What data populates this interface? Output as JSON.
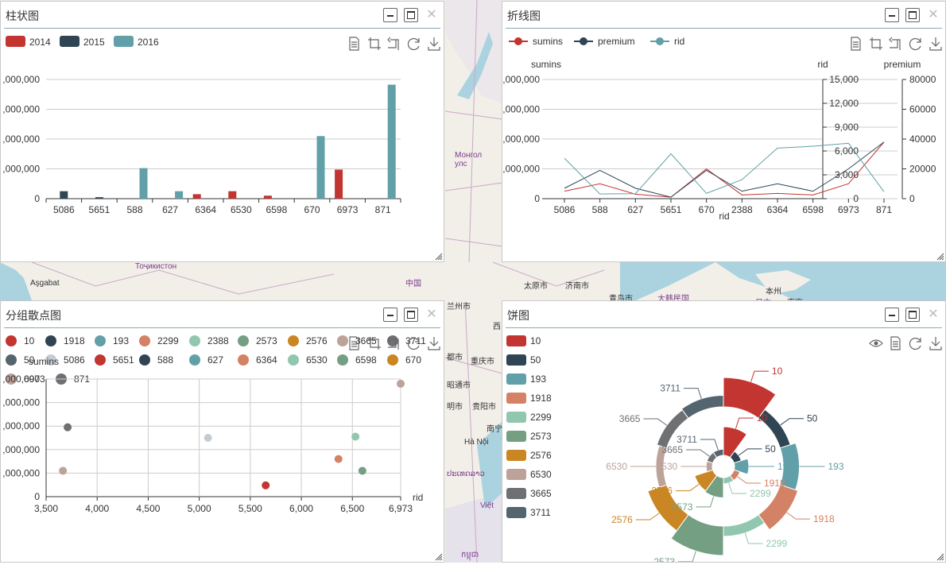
{
  "map": {
    "labels": [
      {
        "text": "Монгол",
        "sub": "улс",
        "cls": "purple"
      },
      {
        "text": "Тоҷикистон",
        "cls": "purple"
      },
      {
        "text": "Aşgabat",
        "cls": ""
      },
      {
        "text": "中国",
        "cls": "purple"
      },
      {
        "text": "太原市",
        "cls": ""
      },
      {
        "text": "济南市",
        "cls": ""
      },
      {
        "text": "青岛市",
        "cls": ""
      },
      {
        "text": "大韩民国",
        "cls": "purple"
      },
      {
        "text": "本州",
        "cls": ""
      },
      {
        "text": "日本",
        "cls": "purple"
      },
      {
        "text": "東京",
        "cls": ""
      },
      {
        "text": "兰州市",
        "cls": ""
      },
      {
        "text": "西",
        "cls": ""
      },
      {
        "text": "都市",
        "cls": ""
      },
      {
        "text": "重庆市",
        "cls": ""
      },
      {
        "text": "昭通市",
        "cls": ""
      },
      {
        "text": "明市",
        "cls": ""
      },
      {
        "text": "贵阳市",
        "cls": ""
      },
      {
        "text": "南宁",
        "cls": ""
      },
      {
        "text": "Hà Nội",
        "cls": ""
      },
      {
        "text": "ປະເທດລາວ",
        "cls": "purple"
      },
      {
        "text": "Việt",
        "cls": "purple"
      },
      {
        "text": "កម្ពុជា",
        "cls": "purple"
      }
    ]
  },
  "panels": {
    "bar": {
      "title": "柱状图"
    },
    "line": {
      "title": "折线图"
    },
    "scatter": {
      "title": "分组散点图"
    },
    "pie": {
      "title": "饼图"
    }
  },
  "colors": {
    "red": "#c23531",
    "navy": "#2f4554",
    "teal": "#61a0a8",
    "salmon": "#d48265",
    "mint": "#91c7ae",
    "green": "#749f83",
    "orange": "#ca8622",
    "rose": "#bda29a",
    "grey": "#6e7074",
    "slate": "#546570",
    "light": "#c4ccd3"
  },
  "toolbar_icons": [
    "data-view-icon",
    "zoom-select-icon",
    "zoom-reset-icon",
    "restore-icon",
    "save-image-icon"
  ],
  "chart_data": [
    {
      "type": "bar",
      "title": "柱状图",
      "categories": [
        "5086",
        "5651",
        "588",
        "627",
        "6364",
        "6530",
        "6598",
        "670",
        "6973",
        "871"
      ],
      "series": [
        {
          "name": "2014",
          "color": "#c23531",
          "values": [
            null,
            null,
            null,
            null,
            300000,
            500000,
            200000,
            null,
            1950000,
            null
          ]
        },
        {
          "name": "2015",
          "color": "#2f4554",
          "values": [
            500000,
            100000,
            null,
            null,
            null,
            null,
            null,
            null,
            null,
            null
          ]
        },
        {
          "name": "2016",
          "color": "#61a0a8",
          "values": [
            null,
            null,
            2050000,
            500000,
            null,
            null,
            null,
            4200000,
            null,
            7650000
          ]
        }
      ],
      "ylim": [
        0,
        8000000
      ],
      "yticks": [
        "0",
        ",000,000",
        ",000,000",
        ",000,000",
        ",000,000"
      ],
      "legend_position": "top-left",
      "grid": true
    },
    {
      "type": "line",
      "title": "折线图",
      "categories": [
        "5086",
        "588",
        "627",
        "5651",
        "670",
        "2388",
        "6364",
        "6598",
        "6973",
        "871"
      ],
      "xlabel": "rid",
      "series": [
        {
          "name": "sumins",
          "color": "#c23531",
          "axis": "sumins",
          "values": [
            500000,
            1000000,
            300000,
            100000,
            2000000,
            250000,
            350000,
            250000,
            1000000,
            3800000
          ]
        },
        {
          "name": "premium",
          "color": "#2f4554",
          "axis": "premium",
          "values": [
            7000,
            19000,
            7000,
            1000,
            19000,
            5000,
            10000,
            5000,
            20000,
            38000
          ]
        },
        {
          "name": "rid",
          "color": "#61a0a8",
          "axis": "rid",
          "values": [
            5086,
            588,
            627,
            5651,
            670,
            2388,
            6364,
            6598,
            6973,
            871
          ]
        }
      ],
      "axes": {
        "sumins": {
          "label": "sumins",
          "lim": [
            0,
            8000000
          ],
          "ticks": [
            "0",
            ",000,000",
            ",000,000",
            ",000,000",
            ",000,000"
          ]
        },
        "rid": {
          "label": "rid",
          "lim": [
            0,
            15000
          ],
          "ticks": [
            "0",
            "3,000",
            "6,000",
            "9,000",
            "12,000",
            "15,000"
          ]
        },
        "premium": {
          "label": "premium",
          "lim": [
            0,
            80000
          ],
          "ticks": [
            "0",
            "20000",
            "40000",
            "60000",
            "80000"
          ]
        }
      },
      "legend_position": "top-left",
      "grid": true
    },
    {
      "type": "scatter",
      "title": "分组散点图",
      "xlabel": "rid",
      "ylabel": "sumins",
      "xlim": [
        3500,
        6973
      ],
      "ylim": [
        0,
        5000000
      ],
      "xticks": [
        "3,500",
        "4,000",
        "4,500",
        "5,000",
        "5,500",
        "6,000",
        "6,500",
        "6,973"
      ],
      "yticks": [
        "0",
        "1,000,000",
        "2,000,000",
        "3,000,000",
        "4,000,000",
        "5,000,000"
      ],
      "ytick_labels_visible": [
        "0",
        ",000,000",
        ",000,000",
        ",000,000",
        ",000,000",
        ",000,000"
      ],
      "legend": [
        {
          "name": "10",
          "color": "#c23531"
        },
        {
          "name": "1918",
          "color": "#2f4554"
        },
        {
          "name": "193",
          "color": "#61a0a8"
        },
        {
          "name": "2299",
          "color": "#d48265"
        },
        {
          "name": "2388",
          "color": "#91c7ae"
        },
        {
          "name": "2573",
          "color": "#749f83"
        },
        {
          "name": "2576",
          "color": "#ca8622"
        },
        {
          "name": "3665",
          "color": "#bda29a"
        },
        {
          "name": "3711",
          "color": "#6e7074"
        },
        {
          "name": "50",
          "color": "#546570"
        },
        {
          "name": "5086",
          "color": "#c4ccd3"
        },
        {
          "name": "5651",
          "color": "#c23531"
        },
        {
          "name": "588",
          "color": "#2f4554"
        },
        {
          "name": "627",
          "color": "#61a0a8"
        },
        {
          "name": "6364",
          "color": "#d48265"
        },
        {
          "name": "6530",
          "color": "#91c7ae"
        },
        {
          "name": "6598",
          "color": "#749f83"
        },
        {
          "name": "670",
          "color": "#ca8622"
        },
        {
          "name": "6973",
          "color": "#bda29a"
        },
        {
          "name": "871",
          "color": "#6e7074"
        }
      ],
      "points": [
        {
          "series": "3665",
          "x": 3665,
          "y": 1100000,
          "color": "#bda29a"
        },
        {
          "series": "3711",
          "x": 3711,
          "y": 2950000,
          "color": "#6e7074"
        },
        {
          "series": "5086",
          "x": 5086,
          "y": 2500000,
          "color": "#c4ccd3"
        },
        {
          "series": "5651",
          "x": 5651,
          "y": 480000,
          "color": "#c23531"
        },
        {
          "series": "6364",
          "x": 6364,
          "y": 1600000,
          "color": "#d48265"
        },
        {
          "series": "6530",
          "x": 6530,
          "y": 2550000,
          "color": "#91c7ae"
        },
        {
          "series": "6598",
          "x": 6598,
          "y": 1100000,
          "color": "#749f83"
        },
        {
          "series": "6973",
          "x": 6973,
          "y": 4800000,
          "color": "#bda29a"
        }
      ],
      "grid": true
    },
    {
      "type": "pie",
      "title": "饼图",
      "legend": [
        {
          "name": "10",
          "color": "#c23531"
        },
        {
          "name": "50",
          "color": "#2f4554"
        },
        {
          "name": "193",
          "color": "#61a0a8"
        },
        {
          "name": "1918",
          "color": "#d48265"
        },
        {
          "name": "2299",
          "color": "#91c7ae"
        },
        {
          "name": "2573",
          "color": "#749f83"
        },
        {
          "name": "2576",
          "color": "#ca8622"
        },
        {
          "name": "6530",
          "color": "#bda29a"
        },
        {
          "name": "3665",
          "color": "#6e7074"
        },
        {
          "name": "3711",
          "color": "#546570"
        }
      ],
      "rings": {
        "outer": [
          {
            "name": "10",
            "value": 100,
            "color": "#c23531"
          },
          {
            "name": "50",
            "value": 22,
            "color": "#2f4554"
          },
          {
            "name": "193",
            "value": 45,
            "color": "#61a0a8"
          },
          {
            "name": "1918",
            "value": 55,
            "color": "#d48265"
          },
          {
            "name": "2299",
            "value": 20,
            "color": "#91c7ae"
          },
          {
            "name": "2573",
            "value": 100,
            "color": "#749f83"
          },
          {
            "name": "2576",
            "value": 60,
            "color": "#ca8622"
          },
          {
            "name": "6530",
            "value": 10,
            "color": "#bda29a"
          },
          {
            "name": "3665",
            "value": 20,
            "color": "#6e7074"
          },
          {
            "name": "3711",
            "value": 25,
            "color": "#546570"
          }
        ],
        "inner": [
          {
            "name": "10",
            "value": 100,
            "color": "#c23531"
          },
          {
            "name": "50",
            "value": 12,
            "color": "#2f4554"
          },
          {
            "name": "193",
            "value": 40,
            "color": "#61a0a8"
          },
          {
            "name": "1918",
            "value": 6,
            "color": "#d48265"
          },
          {
            "name": "2299",
            "value": 6,
            "color": "#91c7ae"
          },
          {
            "name": "2573",
            "value": 65,
            "color": "#749f83"
          },
          {
            "name": "2576",
            "value": 60,
            "color": "#ca8622"
          },
          {
            "name": "6530",
            "value": 6,
            "color": "#bda29a"
          },
          {
            "name": "3665",
            "value": 6,
            "color": "#6e7074"
          },
          {
            "name": "3711",
            "value": 6,
            "color": "#546570"
          }
        ]
      },
      "outer_labels": [
        "10",
        "50",
        "193",
        "1918",
        "2299",
        "2573",
        "2576",
        "6530",
        "3665",
        "3711"
      ],
      "inner_labels": [
        "10",
        "50",
        "193",
        "1918",
        "2299",
        "2573",
        "2576",
        "6530",
        "3665",
        "3711"
      ],
      "rose_type": "radius",
      "legend_position": "left"
    }
  ]
}
